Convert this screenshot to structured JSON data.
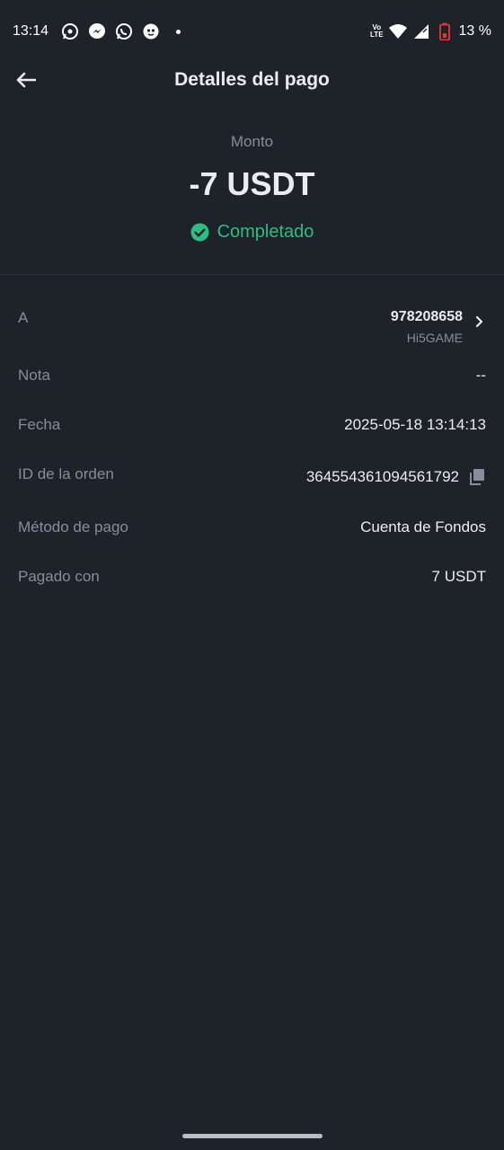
{
  "status_bar": {
    "time": "13:14",
    "battery": "13 %",
    "volte_top": "Vo",
    "volte_bottom": "LTE"
  },
  "header": {
    "title": "Detalles del pago"
  },
  "amount": {
    "label": "Monto",
    "value": "-7 USDT",
    "status": "Completado",
    "status_color": "#2ebd85"
  },
  "details": {
    "recipient": {
      "label": "A",
      "id": "978208658",
      "name": "Hi5GAME"
    },
    "note": {
      "label": "Nota",
      "value": "--"
    },
    "date": {
      "label": "Fecha",
      "value": "2025-05-18 13:14:13"
    },
    "order_id": {
      "label": "ID de la orden",
      "value": "364554361094561792"
    },
    "payment_method": {
      "label": "Método de pago",
      "value": "Cuenta de Fondos"
    },
    "paid_with": {
      "label": "Pagado con",
      "value": "7 USDT"
    }
  },
  "colors": {
    "background": "#1e2329",
    "muted_text": "#848e9c",
    "primary_text": "#eaecef",
    "success": "#2ebd85"
  }
}
